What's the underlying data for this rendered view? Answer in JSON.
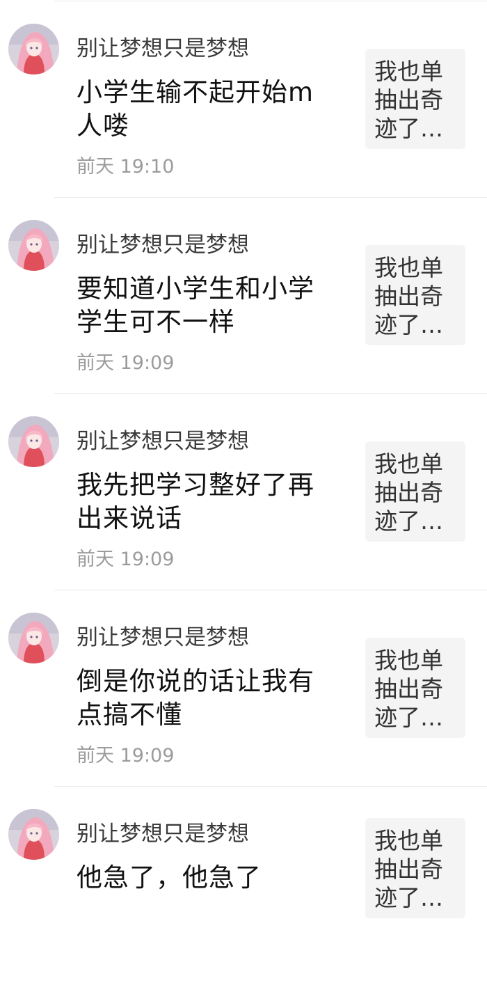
{
  "notifications": [
    {
      "username": "别让梦想只是梦想",
      "message": "小学生输不起开始m人喽",
      "time": "前天 19:10",
      "preview": "我也单抽出奇迹了…"
    },
    {
      "username": "别让梦想只是梦想",
      "message": "要知道小学生和小学学生可不一样",
      "time": "前天 19:09",
      "preview": "我也单抽出奇迹了…"
    },
    {
      "username": "别让梦想只是梦想",
      "message": "我先把学习整好了再出来说话",
      "time": "前天 19:09",
      "preview": "我也单抽出奇迹了…"
    },
    {
      "username": "别让梦想只是梦想",
      "message": "倒是你说的话让我有点搞不懂",
      "time": "前天 19:09",
      "preview": "我也单抽出奇迹了…"
    },
    {
      "username": "别让梦想只是梦想",
      "message": "他急了，他急了",
      "time": "",
      "preview": "我也单抽出奇迹了…"
    }
  ]
}
